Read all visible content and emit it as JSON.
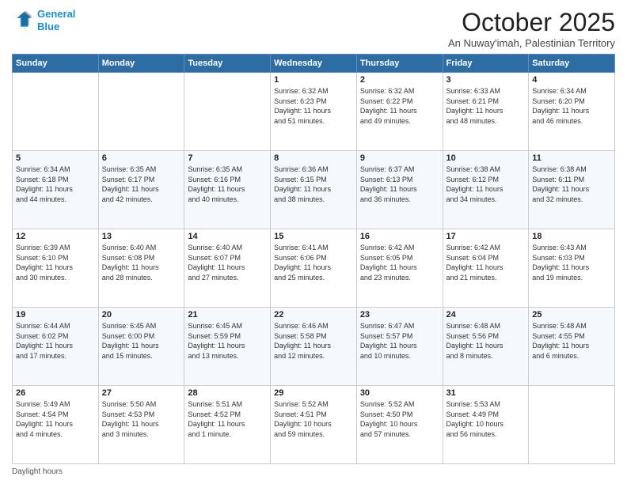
{
  "header": {
    "logo_line1": "General",
    "logo_line2": "Blue",
    "month_title": "October 2025",
    "location": "An Nuway'imah, Palestinian Territory"
  },
  "weekdays": [
    "Sunday",
    "Monday",
    "Tuesday",
    "Wednesday",
    "Thursday",
    "Friday",
    "Saturday"
  ],
  "weeks": [
    [
      {
        "day": "",
        "info": ""
      },
      {
        "day": "",
        "info": ""
      },
      {
        "day": "",
        "info": ""
      },
      {
        "day": "1",
        "info": "Sunrise: 6:32 AM\nSunset: 6:23 PM\nDaylight: 11 hours\nand 51 minutes."
      },
      {
        "day": "2",
        "info": "Sunrise: 6:32 AM\nSunset: 6:22 PM\nDaylight: 11 hours\nand 49 minutes."
      },
      {
        "day": "3",
        "info": "Sunrise: 6:33 AM\nSunset: 6:21 PM\nDaylight: 11 hours\nand 48 minutes."
      },
      {
        "day": "4",
        "info": "Sunrise: 6:34 AM\nSunset: 6:20 PM\nDaylight: 11 hours\nand 46 minutes."
      }
    ],
    [
      {
        "day": "5",
        "info": "Sunrise: 6:34 AM\nSunset: 6:18 PM\nDaylight: 11 hours\nand 44 minutes."
      },
      {
        "day": "6",
        "info": "Sunrise: 6:35 AM\nSunset: 6:17 PM\nDaylight: 11 hours\nand 42 minutes."
      },
      {
        "day": "7",
        "info": "Sunrise: 6:35 AM\nSunset: 6:16 PM\nDaylight: 11 hours\nand 40 minutes."
      },
      {
        "day": "8",
        "info": "Sunrise: 6:36 AM\nSunset: 6:15 PM\nDaylight: 11 hours\nand 38 minutes."
      },
      {
        "day": "9",
        "info": "Sunrise: 6:37 AM\nSunset: 6:13 PM\nDaylight: 11 hours\nand 36 minutes."
      },
      {
        "day": "10",
        "info": "Sunrise: 6:38 AM\nSunset: 6:12 PM\nDaylight: 11 hours\nand 34 minutes."
      },
      {
        "day": "11",
        "info": "Sunrise: 6:38 AM\nSunset: 6:11 PM\nDaylight: 11 hours\nand 32 minutes."
      }
    ],
    [
      {
        "day": "12",
        "info": "Sunrise: 6:39 AM\nSunset: 6:10 PM\nDaylight: 11 hours\nand 30 minutes."
      },
      {
        "day": "13",
        "info": "Sunrise: 6:40 AM\nSunset: 6:08 PM\nDaylight: 11 hours\nand 28 minutes."
      },
      {
        "day": "14",
        "info": "Sunrise: 6:40 AM\nSunset: 6:07 PM\nDaylight: 11 hours\nand 27 minutes."
      },
      {
        "day": "15",
        "info": "Sunrise: 6:41 AM\nSunset: 6:06 PM\nDaylight: 11 hours\nand 25 minutes."
      },
      {
        "day": "16",
        "info": "Sunrise: 6:42 AM\nSunset: 6:05 PM\nDaylight: 11 hours\nand 23 minutes."
      },
      {
        "day": "17",
        "info": "Sunrise: 6:42 AM\nSunset: 6:04 PM\nDaylight: 11 hours\nand 21 minutes."
      },
      {
        "day": "18",
        "info": "Sunrise: 6:43 AM\nSunset: 6:03 PM\nDaylight: 11 hours\nand 19 minutes."
      }
    ],
    [
      {
        "day": "19",
        "info": "Sunrise: 6:44 AM\nSunset: 6:02 PM\nDaylight: 11 hours\nand 17 minutes."
      },
      {
        "day": "20",
        "info": "Sunrise: 6:45 AM\nSunset: 6:00 PM\nDaylight: 11 hours\nand 15 minutes."
      },
      {
        "day": "21",
        "info": "Sunrise: 6:45 AM\nSunset: 5:59 PM\nDaylight: 11 hours\nand 13 minutes."
      },
      {
        "day": "22",
        "info": "Sunrise: 6:46 AM\nSunset: 5:58 PM\nDaylight: 11 hours\nand 12 minutes."
      },
      {
        "day": "23",
        "info": "Sunrise: 6:47 AM\nSunset: 5:57 PM\nDaylight: 11 hours\nand 10 minutes."
      },
      {
        "day": "24",
        "info": "Sunrise: 6:48 AM\nSunset: 5:56 PM\nDaylight: 11 hours\nand 8 minutes."
      },
      {
        "day": "25",
        "info": "Sunrise: 5:48 AM\nSunset: 4:55 PM\nDaylight: 11 hours\nand 6 minutes."
      }
    ],
    [
      {
        "day": "26",
        "info": "Sunrise: 5:49 AM\nSunset: 4:54 PM\nDaylight: 11 hours\nand 4 minutes."
      },
      {
        "day": "27",
        "info": "Sunrise: 5:50 AM\nSunset: 4:53 PM\nDaylight: 11 hours\nand 3 minutes."
      },
      {
        "day": "28",
        "info": "Sunrise: 5:51 AM\nSunset: 4:52 PM\nDaylight: 11 hours\nand 1 minute."
      },
      {
        "day": "29",
        "info": "Sunrise: 5:52 AM\nSunset: 4:51 PM\nDaylight: 10 hours\nand 59 minutes."
      },
      {
        "day": "30",
        "info": "Sunrise: 5:52 AM\nSunset: 4:50 PM\nDaylight: 10 hours\nand 57 minutes."
      },
      {
        "day": "31",
        "info": "Sunrise: 5:53 AM\nSunset: 4:49 PM\nDaylight: 10 hours\nand 56 minutes."
      },
      {
        "day": "",
        "info": ""
      }
    ]
  ],
  "footer": {
    "daylight_label": "Daylight hours"
  }
}
